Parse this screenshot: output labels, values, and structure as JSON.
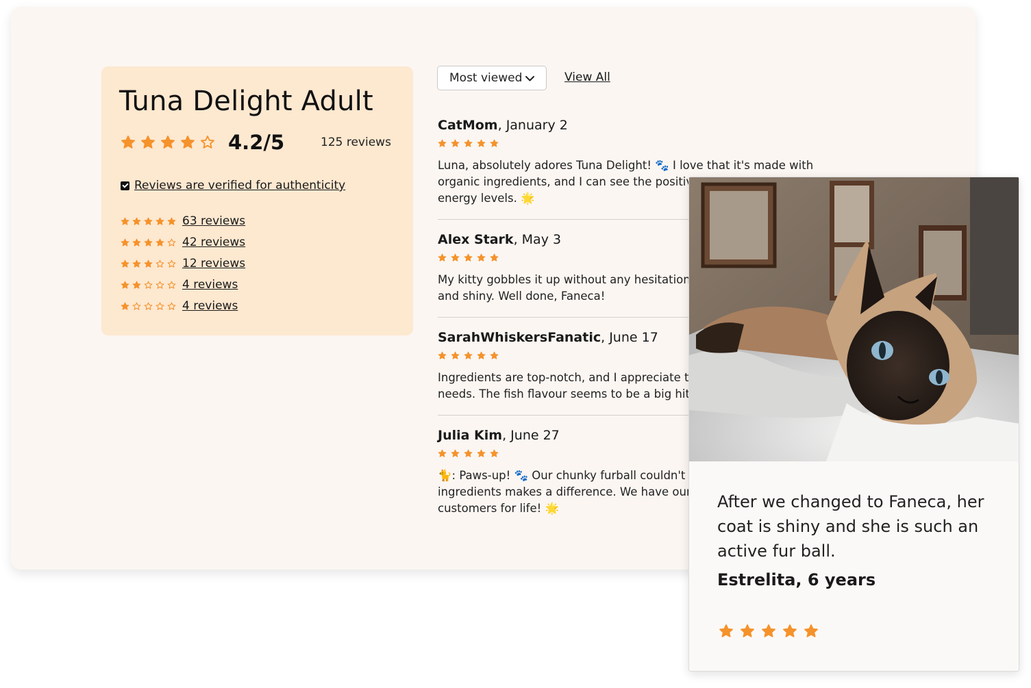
{
  "summary": {
    "product_title": "Tuna Delight Adult",
    "rating_stars": 4,
    "score": "4.2/5",
    "review_count": "125 reviews",
    "verified_label": "Reviews are verified for authenticity",
    "breakdown": [
      {
        "stars": 5,
        "label": "63 reviews"
      },
      {
        "stars": 4,
        "label": "42 reviews"
      },
      {
        "stars": 3,
        "label": "12 reviews"
      },
      {
        "stars": 2,
        "label": "4 reviews"
      },
      {
        "stars": 1,
        "label": "4 reviews"
      }
    ]
  },
  "controls": {
    "sort_selected": "Most viewed",
    "view_all": "View All"
  },
  "reviews": [
    {
      "author": "CatMom",
      "date": ", January 2",
      "stars": 5,
      "text": "Luna, absolutely adores Tuna Delight! 🐾 I love that it's made with organic ingredients, and I can see the positive impact it's had on her energy levels. 🌟"
    },
    {
      "author": "Alex Stark",
      "date": ", May 3",
      "stars": 5,
      "text": "My kitty gobbles it up without any hesitation. Her coat is incredibly soft and shiny. Well done, Faneca!"
    },
    {
      "author": "SarahWhiskersFanatic",
      "date": ", June 17",
      "stars": 5,
      "text": "Ingredients are top-notch, and I appreciate that it meets all my cat's needs. The fish flavour seems to be a big hit⭐"
    },
    {
      "author": "Julia Kim",
      "date": ", June 27",
      "stars": 5,
      "text": "🐈: Paws-up! 🐾 Our chunky furball couldn't get enough. The quality of ingredients makes a difference. We have our happy kitty back. We're customers for life! 🌟"
    }
  ],
  "testimonial": {
    "quote": "After we changed to Faneca, her coat is shiny and she is such an active fur ball.",
    "author": "Estrelita, 6 years",
    "stars": 5
  },
  "colors": {
    "star": "#f5922b",
    "summary_bg": "#fde8d0",
    "stage_bg": "#fbf6f2"
  }
}
